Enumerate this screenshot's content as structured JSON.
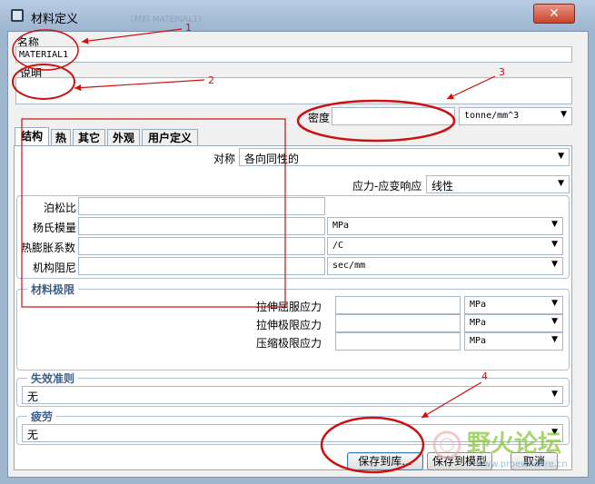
{
  "window": {
    "title": "材料定义",
    "close_glyph": "✕",
    "ghost_title": "（材料 MATERIAL1）"
  },
  "name": {
    "label": "名称",
    "value": "MATERIAL1"
  },
  "description": {
    "label": "说明",
    "value": ""
  },
  "density": {
    "label": "密度",
    "value": "",
    "unit": "tonne/mm^3"
  },
  "tabs": [
    {
      "label": "结构",
      "active": true
    },
    {
      "label": "热",
      "active": false
    },
    {
      "label": "其它",
      "active": false
    },
    {
      "label": "外观",
      "active": false
    },
    {
      "label": "用户定义",
      "active": false
    }
  ],
  "symmetry": {
    "label": "对称",
    "value": "各向同性的"
  },
  "stress_strain": {
    "label": "应力-应变响应",
    "value": "线性"
  },
  "properties": [
    {
      "label": "泊松比",
      "value": "",
      "unit": ""
    },
    {
      "label": "杨氏模量",
      "value": "",
      "unit": "MPa"
    },
    {
      "label": "热膨胀系数",
      "value": "",
      "unit": "/C"
    },
    {
      "label": "机构阻尼",
      "value": "",
      "unit": "sec/mm"
    }
  ],
  "material_limits": {
    "title": "材料极限",
    "rows": [
      {
        "label": "拉伸屈服应力",
        "value": "",
        "unit": "MPa"
      },
      {
        "label": "拉伸极限应力",
        "value": "",
        "unit": "MPa"
      },
      {
        "label": "压缩极限应力",
        "value": "",
        "unit": "MPa"
      }
    ]
  },
  "failure_criterion": {
    "title": "失效准则",
    "value": "无"
  },
  "fatigue": {
    "title": "疲劳",
    "value": "无"
  },
  "buttons": {
    "save_library": "保存到库...",
    "save_model": "保存到模型",
    "cancel": "取消"
  },
  "annotations": [
    "1",
    "2",
    "3",
    "4"
  ],
  "watermark": {
    "text": "野火论坛",
    "url": "www.proewildfire.cn"
  },
  "colors": {
    "annotation": "#cc1111",
    "group_title": "#3a5f8a",
    "watermark": "#8cc63f"
  }
}
